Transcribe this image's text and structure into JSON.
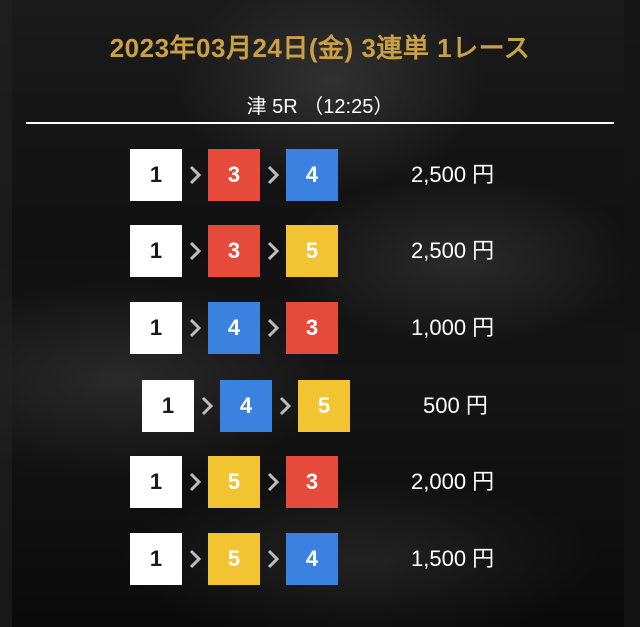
{
  "header": {
    "title": "2023年03月24日(金) 3連単 1レース",
    "race_info": "津 5R （12:25）"
  },
  "colors": {
    "title_gold": "#c9a046",
    "boat_1": "#ffffff",
    "boat_3": "#e64a3a",
    "boat_4": "#3b82e0",
    "boat_5": "#f2c432"
  },
  "results": [
    {
      "first": "1",
      "second": "3",
      "third": "4",
      "payout": "2,500 円"
    },
    {
      "first": "1",
      "second": "3",
      "third": "5",
      "payout": "2,500 円"
    },
    {
      "first": "1",
      "second": "4",
      "third": "3",
      "payout": "1,000 円"
    },
    {
      "first": "1",
      "second": "4",
      "third": "5",
      "payout": "500 円"
    },
    {
      "first": "1",
      "second": "5",
      "third": "3",
      "payout": "2,000 円"
    },
    {
      "first": "1",
      "second": "5",
      "third": "4",
      "payout": "1,500 円"
    }
  ]
}
